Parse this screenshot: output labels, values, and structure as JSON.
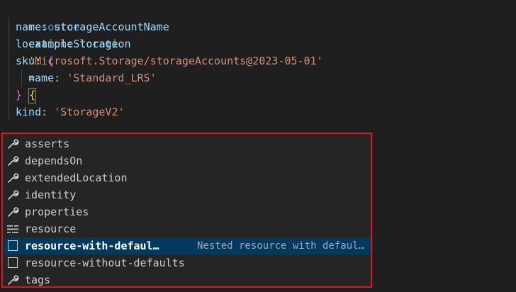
{
  "code": {
    "line1": {
      "kw": "resource",
      "name": "exampleStorage",
      "type": "'Microsoft.Storage/storageAccounts@2023-05-01'",
      "eq": "=",
      "brace": "{"
    },
    "line2": {
      "key": "name",
      "value": "storageAccountName"
    },
    "line3": {
      "key": "location",
      "value": "location"
    },
    "line4": {
      "key": "sku",
      "brace": "{"
    },
    "line5": {
      "key": "name",
      "value": "'Standard_LRS'"
    },
    "line6": {
      "brace": "}"
    },
    "line7": {
      "key": "kind",
      "value": "'StorageV2'"
    }
  },
  "suggestions": {
    "items": [
      {
        "label": "asserts",
        "icon": "wrench-icon"
      },
      {
        "label": "dependsOn",
        "icon": "wrench-icon"
      },
      {
        "label": "extendedLocation",
        "icon": "wrench-icon"
      },
      {
        "label": "identity",
        "icon": "wrench-icon"
      },
      {
        "label": "properties",
        "icon": "wrench-icon"
      },
      {
        "label": "resource",
        "icon": "keyword-icon"
      },
      {
        "label": "resource-with-defaul…",
        "detail": "Nested resource with defaul…",
        "icon": "snippet-icon",
        "selected": true
      },
      {
        "label": "resource-without-defaults",
        "icon": "snippet-icon"
      },
      {
        "label": "tags",
        "icon": "wrench-icon"
      }
    ]
  },
  "colors": {
    "highlight_border": "#e0141e",
    "selected_row": "#04395e"
  }
}
